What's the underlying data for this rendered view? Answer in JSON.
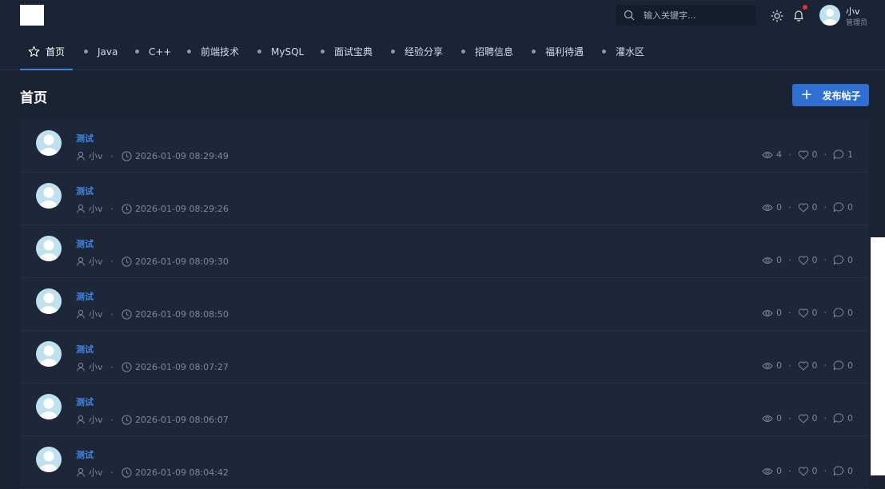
{
  "header": {
    "search_placeholder": "输入关键字...",
    "user": {
      "name": "小v",
      "role": "管理员"
    }
  },
  "nav": {
    "items": [
      {
        "label": "首页",
        "active": true
      },
      {
        "label": "Java"
      },
      {
        "label": "C++"
      },
      {
        "label": "前端技术"
      },
      {
        "label": "MySQL"
      },
      {
        "label": "面试宝典"
      },
      {
        "label": "经验分享"
      },
      {
        "label": "招聘信息"
      },
      {
        "label": "福利待遇"
      },
      {
        "label": "灌水区"
      }
    ]
  },
  "page": {
    "title": "首页",
    "publish_plus": "+",
    "publish_label": "发布帖子"
  },
  "posts": [
    {
      "title": "测试",
      "author": "小v",
      "time": "2026-01-09 08:29:49",
      "views": "4",
      "likes": "0",
      "comments": "1"
    },
    {
      "title": "测试",
      "author": "小v",
      "time": "2026-01-09 08:29:26",
      "views": "0",
      "likes": "0",
      "comments": "0"
    },
    {
      "title": "测试",
      "author": "小v",
      "time": "2026-01-09 08:09:30",
      "views": "0",
      "likes": "0",
      "comments": "0"
    },
    {
      "title": "测试",
      "author": "小v",
      "time": "2026-01-09 08:08:50",
      "views": "0",
      "likes": "0",
      "comments": "0"
    },
    {
      "title": "测试",
      "author": "小v",
      "time": "2026-01-09 08:07:27",
      "views": "0",
      "likes": "0",
      "comments": "0"
    },
    {
      "title": "测试",
      "author": "小v",
      "time": "2026-01-09 08:06:07",
      "views": "0",
      "likes": "0",
      "comments": "0"
    },
    {
      "title": "测试",
      "author": "小v",
      "time": "2026-01-09 08:04:42",
      "views": "0",
      "likes": "0",
      "comments": "0"
    }
  ],
  "meta_separator": "·",
  "colors": {
    "background": "#1b2234",
    "accent": "#2f6fd1",
    "title_link": "#3e86e0",
    "notification_dot": "#e0343c"
  }
}
